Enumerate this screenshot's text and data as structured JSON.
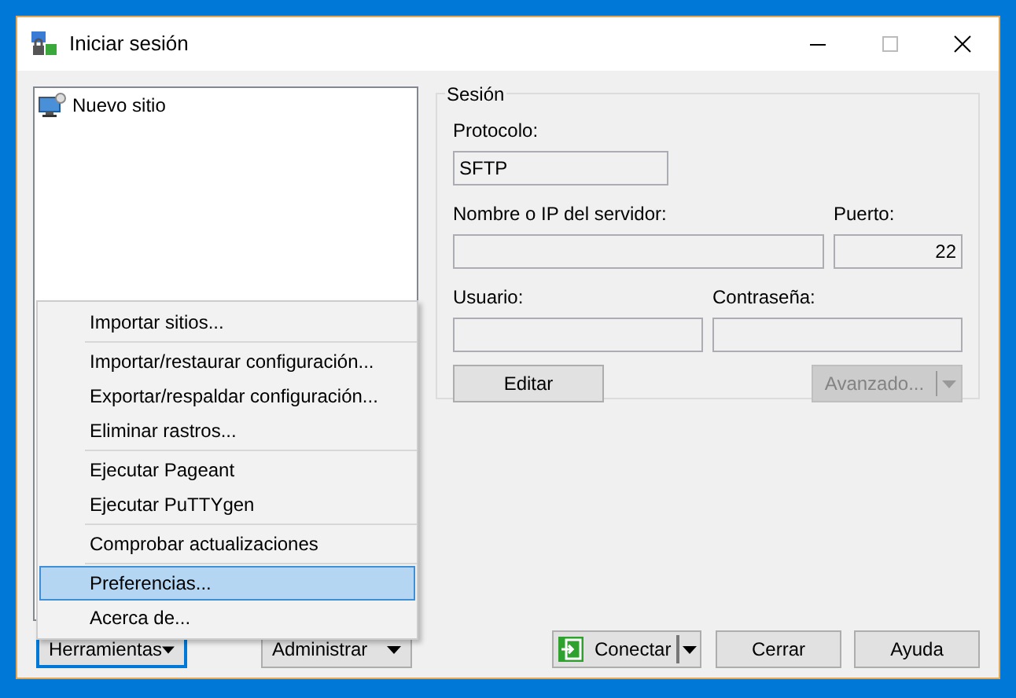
{
  "window": {
    "title": "Iniciar sesión"
  },
  "site_tree": {
    "items": [
      {
        "label": "Nuevo sitio",
        "selected": false
      }
    ]
  },
  "session": {
    "legend": "Sesión",
    "rows": [
      [
        {
          "label": "Protocolo:",
          "value": "SFTP",
          "kind": "protocol"
        }
      ],
      [
        {
          "label": "Nombre o IP del servidor:",
          "kind": "wide"
        },
        {
          "label": "Puerto:",
          "value": "22",
          "kind": "port"
        }
      ],
      [
        {
          "label": "Usuario:",
          "kind": "half"
        },
        {
          "label": "Contraseña:",
          "kind": "half"
        }
      ]
    ],
    "edit_button": {
      "label": "Editar",
      "disabled": false
    },
    "advanced_button": {
      "label": "Avanzado...",
      "disabled": true
    }
  },
  "menu": [
    {
      "kind": "item",
      "label": "Importar sitios...",
      "selected": false
    },
    {
      "kind": "separator"
    },
    {
      "kind": "item",
      "label": "Importar/restaurar configuración...",
      "selected": false
    },
    {
      "kind": "item",
      "label": "Exportar/respaldar configuración...",
      "selected": false
    },
    {
      "kind": "item",
      "label": "Eliminar rastros...",
      "selected": false
    },
    {
      "kind": "separator"
    },
    {
      "kind": "item",
      "label": "Ejecutar Pageant",
      "selected": false
    },
    {
      "kind": "item",
      "label": "Ejecutar PuTTYgen",
      "selected": false
    },
    {
      "kind": "separator"
    },
    {
      "kind": "item",
      "label": "Comprobar actualizaciones",
      "selected": false
    },
    {
      "kind": "separator"
    },
    {
      "kind": "item",
      "label": "Preferencias...",
      "selected": true
    },
    {
      "kind": "item",
      "label": "Acerca de...",
      "selected": false
    }
  ],
  "buttons": [
    {
      "kind": "dropdown",
      "label": "Herramientas",
      "focused": true
    },
    {
      "kind": "dropdown",
      "label": "Administrar",
      "focused": false
    },
    {
      "kind": "split",
      "label": "Conectar",
      "focused": false
    },
    {
      "kind": "plain",
      "label": "Cerrar",
      "focused": false
    },
    {
      "kind": "plain",
      "label": "Ayuda",
      "focused": false
    }
  ]
}
